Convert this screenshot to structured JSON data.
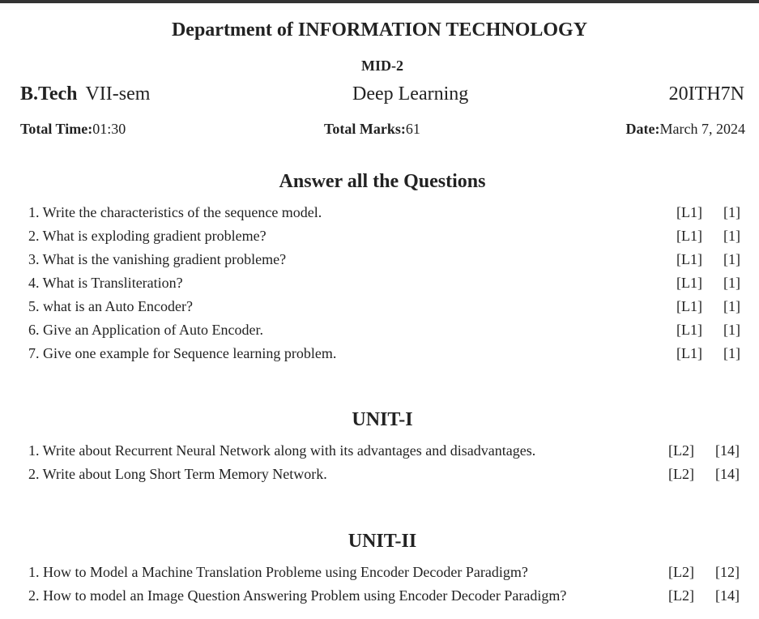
{
  "header": {
    "department": "Department of INFORMATION TECHNOLOGY",
    "exam": "MID-2",
    "course_label": "B.Tech",
    "semester": "VII-sem",
    "subject": "Deep Learning",
    "subject_code": "20ITH7N",
    "time_label": "Total Time:",
    "time_value": "01:30",
    "marks_label": "Total Marks:",
    "marks_value": "61",
    "date_label": "Date:",
    "date_value": "March 7, 2024"
  },
  "part_a": {
    "title": "Answer all the Questions",
    "questions": [
      {
        "text": "1. Write the characteristics of the sequence model.",
        "level": "[L1]",
        "marks": "[1]"
      },
      {
        "text": "2. What is exploding gradient probleme?",
        "level": "[L1]",
        "marks": "[1]"
      },
      {
        "text": "3. What is the vanishing gradient probleme?",
        "level": "[L1]",
        "marks": "[1]"
      },
      {
        "text": "4. What is Transliteration?",
        "level": "[L1]",
        "marks": "[1]"
      },
      {
        "text": "5. what is an Auto Encoder?",
        "level": "[L1]",
        "marks": "[1]"
      },
      {
        "text": "6. Give an Application of Auto Encoder.",
        "level": "[L1]",
        "marks": "[1]"
      },
      {
        "text": "7. Give one example for Sequence learning problem.",
        "level": "[L1]",
        "marks": "[1]"
      }
    ]
  },
  "unit1": {
    "title": "UNIT-I",
    "questions": [
      {
        "text": "1. Write about Recurrent Neural Network along with its advantages and disadvantages.",
        "level": "[L2]",
        "marks": "[14]"
      },
      {
        "text": "2. Write about Long Short Term Memory Network.",
        "level": "[L2]",
        "marks": "[14]"
      }
    ]
  },
  "unit2": {
    "title": "UNIT-II",
    "questions": [
      {
        "text": "1. How to Model a Machine Translation Probleme using Encoder Decoder Paradigm?",
        "level": "[L2]",
        "marks": "[12]"
      },
      {
        "text": "2. How to model an Image Question Answering Problem using Encoder Decoder Paradigm?",
        "level": "[L2]",
        "marks": "[14]"
      }
    ]
  }
}
